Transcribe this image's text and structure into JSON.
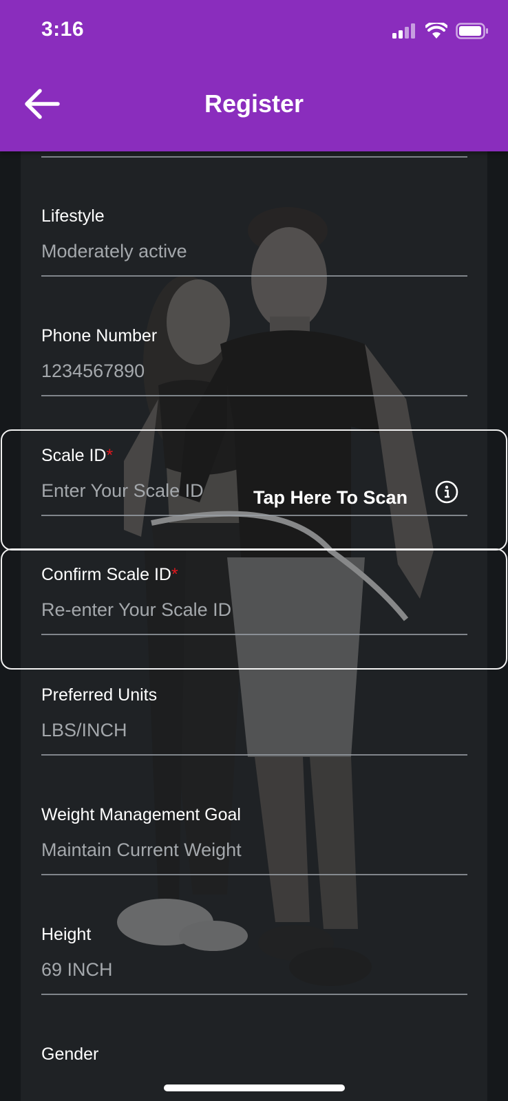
{
  "status_bar": {
    "time": "3:16"
  },
  "header": {
    "title": "Register"
  },
  "fields": {
    "lifestyle": {
      "label": "Lifestyle",
      "value": "Moderately active"
    },
    "phone": {
      "label": "Phone Number",
      "value": "1234567890"
    },
    "scale_id": {
      "label": "Scale ID",
      "required_mark": "*",
      "placeholder": "Enter Your Scale ID",
      "scan_label": "Tap Here To Scan"
    },
    "confirm_scale_id": {
      "label": "Confirm Scale ID",
      "required_mark": "*",
      "placeholder": "Re-enter Your Scale ID"
    },
    "units": {
      "label": "Preferred Units",
      "value": "LBS/INCH"
    },
    "goal": {
      "label": "Weight Management Goal",
      "value": "Maintain Current Weight"
    },
    "height": {
      "label": "Height",
      "value": "69 INCH"
    },
    "gender": {
      "label": "Gender"
    }
  },
  "colors": {
    "header": "#8a2dbd",
    "required": "#e0181e",
    "background": "#15181b"
  }
}
